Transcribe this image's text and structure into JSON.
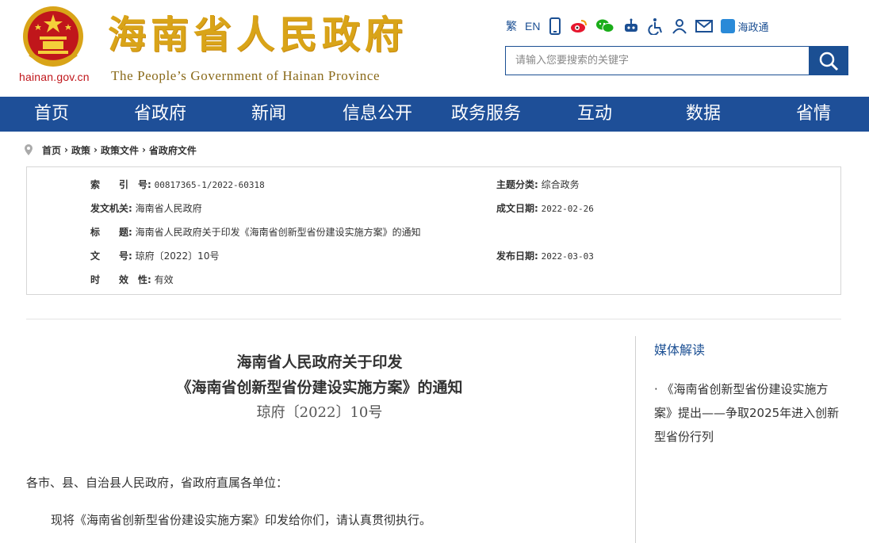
{
  "header": {
    "domain": "hainan.gov.cn",
    "title_cn": "海南省人民政府",
    "title_en": "The People’s Government  of Hainan Province",
    "tools": {
      "traditional": "繁",
      "english": "EN",
      "haizhengtong": "海政通"
    },
    "search_placeholder": "请输入您要搜索的关键字"
  },
  "nav": [
    "首页",
    "省政府",
    "新闻",
    "信息公开",
    "政务服务",
    "互动",
    "数据",
    "省情"
  ],
  "breadcrumb": [
    "首页",
    "政策",
    "政策文件",
    "省政府文件"
  ],
  "info": {
    "index_label": "索　　引　号:",
    "index_value": "00817365-1/2022-60318",
    "topic_label": "主题分类:",
    "topic_value": "综合政务",
    "issuer_label": "发文机关:",
    "issuer_value": "海南省人民政府",
    "date_label": "成文日期:",
    "date_value": "2022-02-26",
    "title_label": "标　　题:",
    "title_value": "海南省人民政府关于印发《海南省创新型省份建设实施方案》的通知",
    "docno_label": "文　　号:",
    "docno_value": "琼府〔2022〕10号",
    "publish_label": "发布日期:",
    "publish_value": "2022-03-03",
    "validity_label": "时　　效　性:",
    "validity_value": "有效"
  },
  "article": {
    "title_line1": "海南省人民政府关于印发",
    "title_line2": "《海南省创新型省份建设实施方案》的通知",
    "doc_number": "琼府〔2022〕10号",
    "salutation": "各市、县、自治县人民政府，省政府直属各单位：",
    "body": "现将《海南省创新型省份建设实施方案》印发给你们，请认真贯彻执行。"
  },
  "sidebar": {
    "title": "媒体解读",
    "link": "· 《海南省创新型省份建设实施方案》提出——争取2025年进入创新型省份行列"
  },
  "colors": {
    "nav_bg": "#1e4f98",
    "title_gold": "#d9a418",
    "emblem_red": "#c0161b"
  }
}
